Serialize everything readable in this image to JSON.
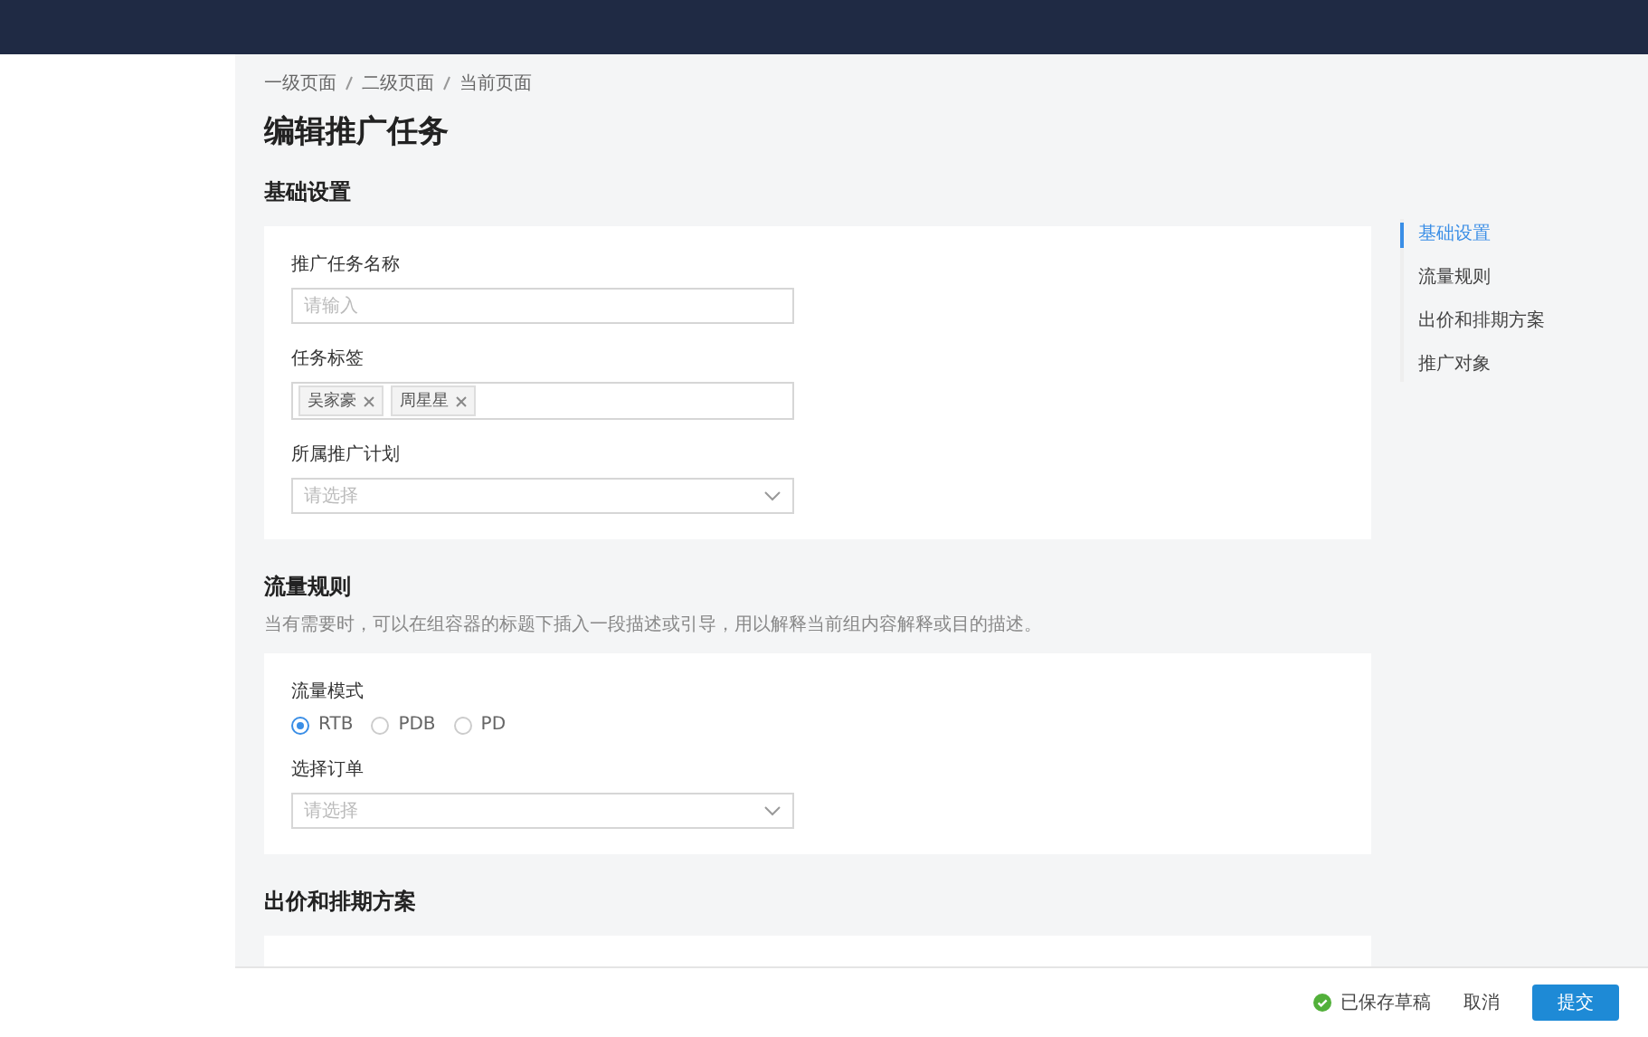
{
  "breadcrumb": [
    "一级页面",
    "二级页面",
    "当前页面"
  ],
  "title": "编辑推广任务",
  "sections": [
    {
      "title": "基础设置",
      "fields": [
        {
          "kind": "input",
          "label": "推广任务名称",
          "placeholder": "请输入"
        },
        {
          "kind": "tags",
          "label": "任务标签",
          "tags": [
            "吴家豪",
            "周星星"
          ]
        },
        {
          "kind": "select",
          "label": "所属推广计划",
          "placeholder": "请选择"
        }
      ]
    },
    {
      "title": "流量规则",
      "description": "当有需要时，可以在组容器的标题下插入一段描述或引导，用以解释当前组内容解释或目的描述。",
      "fields": [
        {
          "kind": "radio",
          "label": "流量模式",
          "options": [
            {
              "label": "RTB",
              "selected": true
            },
            {
              "label": "PDB",
              "selected": false
            },
            {
              "label": "PD",
              "selected": false
            }
          ]
        },
        {
          "kind": "select",
          "label": "选择订单",
          "placeholder": "请选择"
        }
      ]
    },
    {
      "title": "出价和排期方案"
    }
  ],
  "anchors": [
    {
      "label": "基础设置",
      "selected": true
    },
    {
      "label": "流量规则",
      "selected": false
    },
    {
      "label": "出价和排期方案",
      "selected": false
    },
    {
      "label": "推广对象",
      "selected": false
    }
  ],
  "footer": {
    "status": "已保存草稿",
    "buttons": [
      {
        "label": "取消",
        "kind": "text"
      },
      {
        "label": "提交",
        "kind": "primary"
      }
    ]
  }
}
